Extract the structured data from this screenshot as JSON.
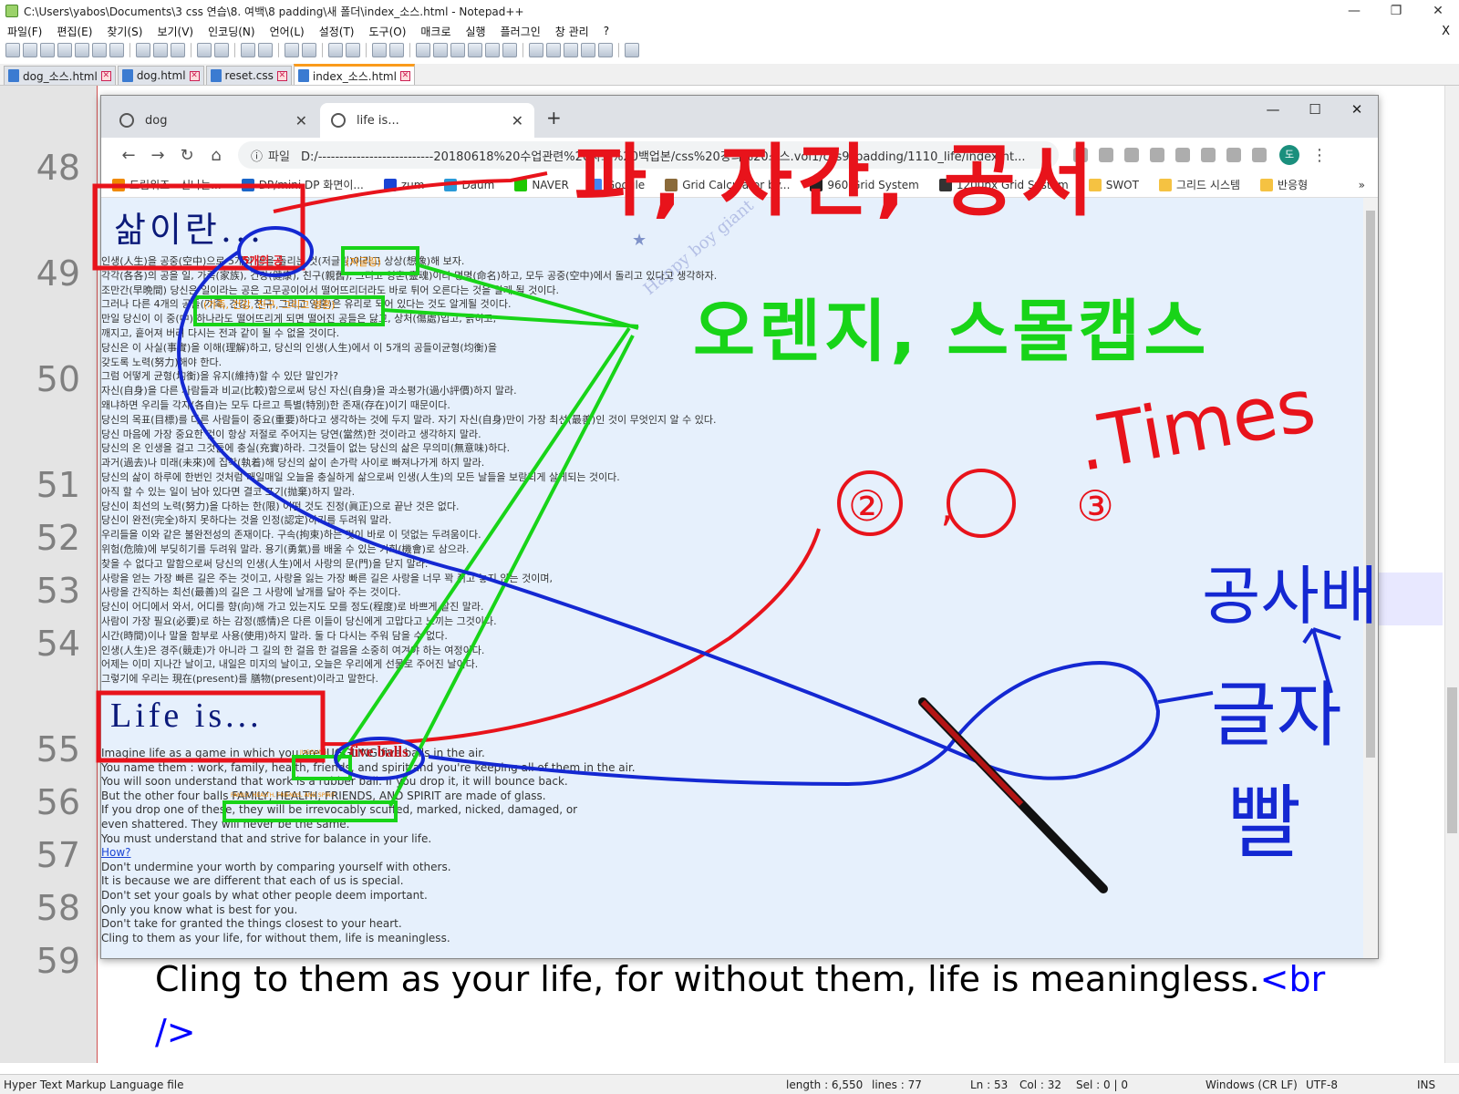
{
  "npp": {
    "title": "C:\\Users\\yabos\\Documents\\3 css 연습\\8. 여백\\8 padding\\새 폴더\\index_소스.html - Notepad++",
    "window_controls": [
      "—",
      "❐",
      "✕"
    ],
    "menu": [
      "파일(F)",
      "편집(E)",
      "찾기(S)",
      "보기(V)",
      "인코딩(N)",
      "언어(L)",
      "설정(T)",
      "도구(O)",
      "매크로",
      "실행",
      "플러그인",
      "창 관리",
      "?"
    ],
    "menu_close": "X",
    "tabs": [
      "dog_소스.html",
      "dog.html",
      "reset.css",
      "index_소스.html"
    ],
    "line_numbers": [
      "48",
      "49",
      "50",
      "51",
      "52",
      "53",
      "54",
      "55",
      "56",
      "57",
      "58",
      "59"
    ],
    "visible_code": {
      "line59": "Cling to them as your life, for without them, life is meaningless.",
      "line59_tag_a": "<br",
      "line59_tag_b": "/>",
      "edge_48": "t",
      "edge_54": "r"
    },
    "status": {
      "lang": "Hyper Text Markup Language file",
      "length": "length : 6,550",
      "lines": "lines : 77",
      "ln": "Ln : 53",
      "col": "Col : 32",
      "sel": "Sel : 0 | 0",
      "eol": "Windows (CR LF)",
      "enc": "UTF-8",
      "ins": "INS"
    }
  },
  "chrome": {
    "tabs": [
      {
        "title": "dog"
      },
      {
        "title": "life is..."
      }
    ],
    "new_tab": "+",
    "window_controls": [
      "—",
      "☐",
      "✕"
    ],
    "address_label": "파일",
    "address": "D:/---------------------------20180618%20수업관련%20자료%20백업본/css%20강의%20소스.vol1/css9_padding/1110_life/index.ht...",
    "avatar": "도",
    "bookmarks": [
      {
        "label": "드림위즈 - 신나는...",
        "color": "#f08a00"
      },
      {
        "label": "DP/mini DP 화면이...",
        "color": "#1a66c9"
      },
      {
        "label": "zum",
        "color": "#1a44d4"
      },
      {
        "label": "Daum",
        "color": "#2a9ad8"
      },
      {
        "label": "NAVER",
        "color": "#1ec800"
      },
      {
        "label": "Google",
        "color": "#4285f4"
      },
      {
        "label": "Grid Calculator by...",
        "color": "#8a6a3a"
      },
      {
        "label": "960 Grid System",
        "color": "#222222"
      },
      {
        "label": "1200px Grid System",
        "color": "#333333"
      },
      {
        "label": "SWOT",
        "color": "#f5c242"
      },
      {
        "label": "그리드 시스템",
        "color": "#f5c242"
      },
      {
        "label": "반응형",
        "color": "#f5c242"
      }
    ],
    "bookmarks_more": "»"
  },
  "page": {
    "title_ko": "삶이란...",
    "inline_red": "5개의 공",
    "inline_orange": "(저글링)",
    "inline_orange2": "(가족, 건강, 친구, 그리고 영혼)",
    "ko_lines": [
      "인생(人生)을 공중(空中)으로 5개의 공을 돌리는 것(저글링)이라고 상상(想像)해 보자.",
      "각각(各各)의 공을 일, 가족(家族), 건강(健康), 친구(親舊), 그리고 영혼(靈魂)이라 명명(命名)하고, 모두 공중(空中)에서 돌리고 있다고 생각하자.",
      "조만간(早晩間) 당신은 일이라는 공은 고무공이어서 떨어뜨리더라도 바로 튀어 오른다는 것을 알게 될 것이다.",
      "그러나 다른 4개의 공들(가족, 건강, 친구, 그리고 영혼)은 유리로 되어 있다는 것도 알게될 것이다.",
      "만일 당신이 이 중(中) 하나라도 떨어뜨리게 되면 떨어진 공들은 닳고, 상처(傷處)입고, 긁히고,",
      "깨지고, 흩어져 버려 다시는 전과 같이 될 수 없을 것이다.",
      "당신은 이 사실(事實)을 이해(理解)하고, 당신의 인생(人生)에서 이 5개의 공들이균형(均衡)을",
      "갖도록 노력(努力)해야 한다.",
      "그럼 어떻게 균형(均衡)을 유지(維持)할 수 있단 말인가?",
      "자신(自身)을 다른 사람들과 비교(比較)함으로써 당신 자신(自身)을 과소평가(過小評價)하지 말라.",
      "왜냐하면 우리들 각자(各自)는 모두 다르고 특별(特別)한 존재(存在)이기 때문이다.",
      "당신의 목표(目標)를 다른 사람들이 중요(重要)하다고 생각하는 것에 두지 말라. 자기 자신(自身)만이 가장 최선(最善)인 것이 무엇인지 알 수 있다.",
      "당신 마음에 가장 중요한 것이 항상 저절로 주어지는 당연(當然)한 것이라고 생각하지 말라.",
      "당신의 온 인생을 걸고 그것들에 충실(充實)하라. 그것들이 없는 당신의 삶은 무의미(無意味)하다.",
      "과거(過去)나 미래(未來)에 집착(執着)해 당신의 삶이 손가락 사이로 빠져나가게 하지 말라.",
      "당신의 삶이 하루에 한번인 것처럼 매일매일 오늘을 충실하게 삶으로써 인생(人生)의 모든 날들을 보람되게 살게되는 것이다.",
      "아직 할 수 있는 일이 남아 있다면 결코 포기(抛棄)하지 말라.",
      "당신이 최선의 노력(努力)을 다하는 한(限) 어떤 것도 진정(眞正)으로 끝난 것은 없다.",
      "당신이 완전(完全)하지 못하다는 것을 인정(認定)하기를 두려워 말라.",
      "우리들을 이와 같은 불완전성의 존재이다. 구속(拘束)하는 것이 바로 이 덧없는 두려움이다.",
      "위험(危險)에 부딪히기를 두려워 말라. 용기(勇氣)를 배울 수 있는 기회(機會)로 삼으라.",
      "찾을 수 없다고 말함으로써 당신의 인생(人生)에서 사랑의 문(門)을 닫지 말라.",
      "사랑을 얻는 가장 빠른 길은 주는 것이고, 사랑을 잃는 가장 빠른 길은 사랑을 너무 꽉 쥐고 놓지 않는 것이며,",
      "사랑을 간직하는 최선(最善)의 길은 그 사랑에 날개를 달아 주는 것이다.",
      "당신이 어디에서 와서, 어디를 향(向)해 가고 있는지도 모를 정도(程度)로 바쁘게 살진 말라.",
      "사람이 가장 필요(必要)로 하는 감정(感情)은 다른 이들이 당신에게 고맙다고 느끼는 그것이다.",
      "시간(時間)이나 말을 함부로 사용(使用)하지 말라. 둘 다 다시는 주워 담을 수 없다.",
      "인생(人生)은 경주(競走)가 아니라 그 길의 한 걸음 한 걸음을 소중히 여겨야 하는 여정이다.",
      "어제는 이미 지나간 날이고, 내일은 미지의 날이고, 오늘은 우리에게 선물로 주어진 날이다.",
      "그렇기에 우리는 現在(present)를 膳物(present)이라고 말한다."
    ],
    "title_en": "Life is...",
    "en_small_orange": "JUGGLING",
    "en_big_red": "five balls",
    "en_small_orange2": "FAMILY, HEALTH, FRIENDS, AND SPIRIT",
    "en_lines": [
      "Imagine life as a game in which you are JUGGLING five balls in the air.",
      "You name them : work, family, health, friends, and spirit and you're keeping all of them in the air.",
      "You will soon understand that work is a rubber ball. If you drop it, it will bounce back.",
      "But the other four balls FAMILY, HEALTH, FRIENDS, AND SPIRIT are made of glass.",
      "If you drop one of these, they will be irrevocably scuffed, marked, nicked, damaged, or",
      "even shattered. They will never be the same.",
      "You must understand that and strive for balance in your life."
    ],
    "en_link": "How?",
    "en_lines2": [
      "Don't undermine your worth by comparing yourself with others.",
      "It is because we are different that each of us is special.",
      "Don't set your goals by what other people deem important.",
      "Only you know what is best for you.",
      "Don't take for granted the things closest to your heart.",
      "Cling to them as your life, for without them, life is meaningless."
    ],
    "watermark": "Happy boy giant",
    "star": "★"
  },
  "annotations": {
    "note_top": "파, 자간, 공서",
    "note_green": "오렌지, 스몰캡스",
    "note_times": ".Times",
    "note_circles": "②, ③",
    "note_right_a": "공사배",
    "note_right_b": "글자",
    "note_right_c": "빨"
  },
  "colors": {
    "annot_red": "#e8131b",
    "annot_green": "#18d418",
    "annot_blue": "#1428d2",
    "page_bg": "#e6f0fc",
    "title_navy": "#0b1a7a"
  }
}
